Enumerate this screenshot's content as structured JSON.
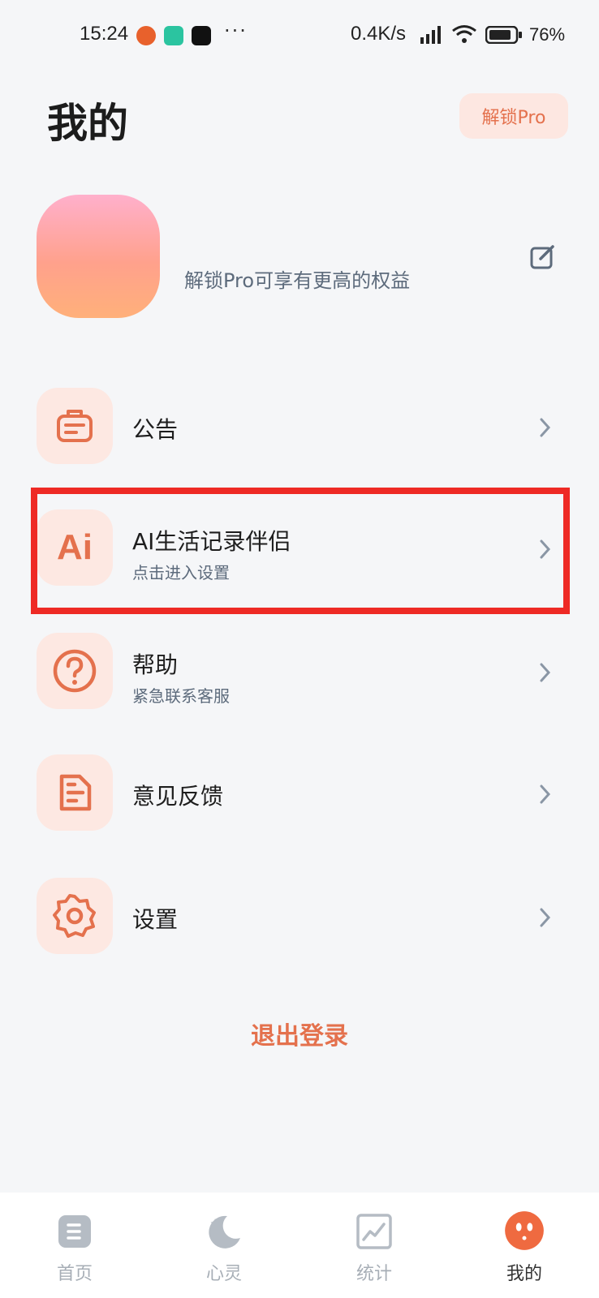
{
  "status_bar": {
    "time": "15:24",
    "dots": "···",
    "net_speed": "0.4K/s",
    "battery": "76%"
  },
  "header": {
    "title": "我的",
    "unlock_pro": "解锁Pro"
  },
  "profile": {
    "subtitle": "解锁Pro可享有更高的权益"
  },
  "menu": [
    {
      "title": "公告",
      "subtitle": "",
      "icon": "announcement-icon"
    },
    {
      "title": "AI生活记录伴侣",
      "subtitle": "点击进入设置",
      "icon": "ai-icon",
      "icon_text": "Ai"
    },
    {
      "title": "帮助",
      "subtitle": "紧急联系客服",
      "icon": "help-icon"
    },
    {
      "title": "意见反馈",
      "subtitle": "",
      "icon": "feedback-icon"
    },
    {
      "title": "设置",
      "subtitle": "",
      "icon": "settings-icon"
    }
  ],
  "logout": "退出登录",
  "bottom_nav": [
    {
      "label": "首页",
      "icon": "home-icon",
      "active": false
    },
    {
      "label": "心灵",
      "icon": "moon-icon",
      "active": false
    },
    {
      "label": "统计",
      "icon": "chart-icon",
      "active": false
    },
    {
      "label": "我的",
      "icon": "profile-icon",
      "active": true
    }
  ],
  "colors": {
    "accent": "#e4714d",
    "icon_bg": "#fde8e2",
    "highlight": "#ee2a25",
    "background": "#f5f6f8"
  }
}
